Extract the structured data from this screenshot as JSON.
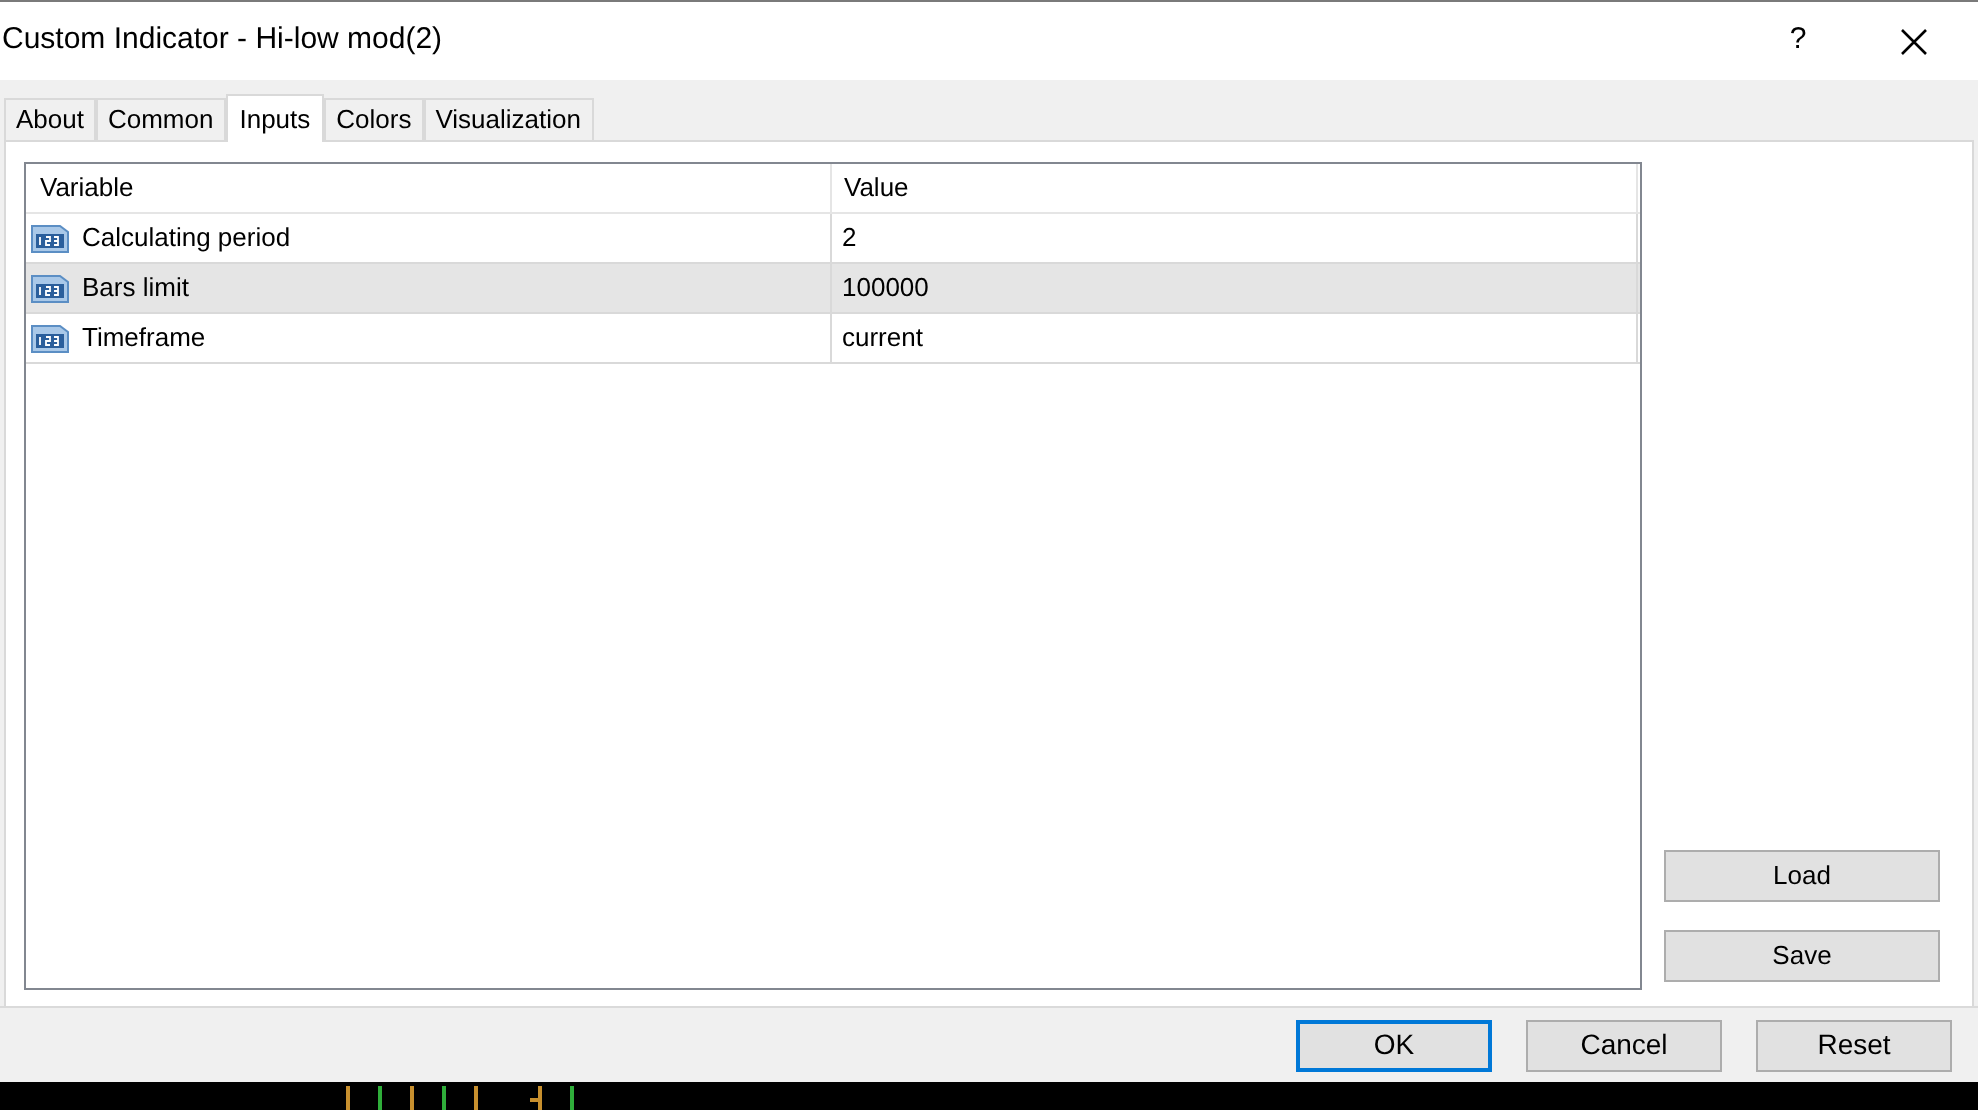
{
  "window": {
    "title": "Custom Indicator - Hi-low mod(2)",
    "help": "?"
  },
  "tabs": [
    {
      "label": "About",
      "selected": false
    },
    {
      "label": "Common",
      "selected": false
    },
    {
      "label": "Inputs",
      "selected": true
    },
    {
      "label": "Colors",
      "selected": false
    },
    {
      "label": "Visualization",
      "selected": false
    }
  ],
  "table": {
    "columns": [
      "Variable",
      "Value"
    ],
    "rows": [
      {
        "variable": "Calculating period",
        "value": "2",
        "selected": false
      },
      {
        "variable": "Bars limit",
        "value": "100000",
        "selected": true
      },
      {
        "variable": "Timeframe",
        "value": "current",
        "selected": false
      }
    ]
  },
  "side_buttons": [
    "Load",
    "Save"
  ],
  "footer_buttons": [
    {
      "label": "OK",
      "default": true
    },
    {
      "label": "Cancel",
      "default": false
    },
    {
      "label": "Reset",
      "default": false
    }
  ]
}
